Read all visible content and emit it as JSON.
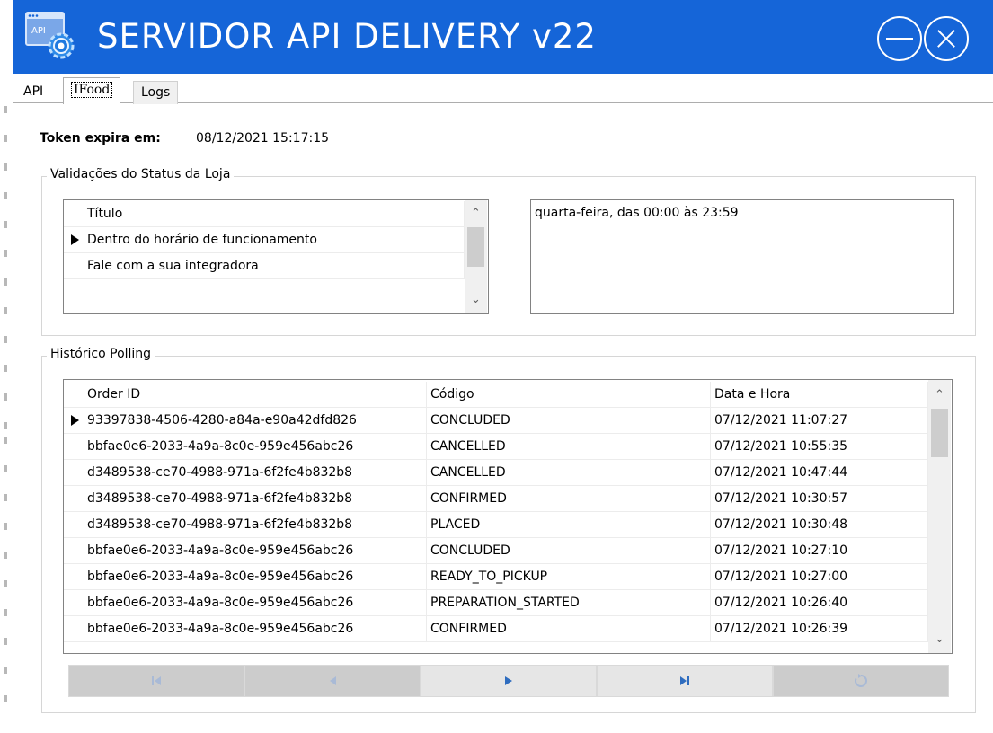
{
  "window": {
    "title": "SERVIDOR API DELIVERY v22",
    "icon_text": "API",
    "icon": "api-gear-icon",
    "accent_color": "#1565d8"
  },
  "tabs": [
    {
      "label": "API"
    },
    {
      "label": "IFood",
      "active": true
    },
    {
      "label": "Logs"
    }
  ],
  "token": {
    "label": "Token expira em:",
    "value": "08/12/2021 15:17:15"
  },
  "status_group": {
    "title": "Validações do Status da Loja",
    "column_header": "Título",
    "rows": [
      {
        "title": "Dentro do horário de funcionamento",
        "selected": true
      },
      {
        "title": "Fale com a sua integradora",
        "selected": false
      }
    ],
    "detail_text": "quarta-feira, das 00:00 às 23:59"
  },
  "polling_group": {
    "title": "Histórico Polling",
    "columns": [
      "Order ID",
      "Código",
      "Data e Hora"
    ],
    "rows": [
      {
        "order_id": "93397838-4506-4280-a84a-e90a42dfd826",
        "code": "CONCLUDED",
        "datetime": "07/12/2021 11:07:27",
        "selected": true
      },
      {
        "order_id": "bbfae0e6-2033-4a9a-8c0e-959e456abc26",
        "code": "CANCELLED",
        "datetime": "07/12/2021 10:55:35"
      },
      {
        "order_id": "d3489538-ce70-4988-971a-6f2fe4b832b8",
        "code": "CANCELLED",
        "datetime": "07/12/2021 10:47:44"
      },
      {
        "order_id": "d3489538-ce70-4988-971a-6f2fe4b832b8",
        "code": "CONFIRMED",
        "datetime": "07/12/2021 10:30:57"
      },
      {
        "order_id": "d3489538-ce70-4988-971a-6f2fe4b832b8",
        "code": "PLACED",
        "datetime": "07/12/2021 10:30:48"
      },
      {
        "order_id": "bbfae0e6-2033-4a9a-8c0e-959e456abc26",
        "code": "CONCLUDED",
        "datetime": "07/12/2021 10:27:10"
      },
      {
        "order_id": "bbfae0e6-2033-4a9a-8c0e-959e456abc26",
        "code": "READY_TO_PICKUP",
        "datetime": "07/12/2021 10:27:00"
      },
      {
        "order_id": "bbfae0e6-2033-4a9a-8c0e-959e456abc26",
        "code": "PREPARATION_STARTED",
        "datetime": "07/12/2021 10:26:40"
      },
      {
        "order_id": "bbfae0e6-2033-4a9a-8c0e-959e456abc26",
        "code": "CONFIRMED",
        "datetime": "07/12/2021 10:26:39"
      }
    ]
  },
  "navigator": {
    "buttons": [
      {
        "icon": "first-record-icon",
        "enabled": false
      },
      {
        "icon": "prior-record-icon",
        "enabled": false
      },
      {
        "icon": "next-record-icon",
        "enabled": true
      },
      {
        "icon": "last-record-icon",
        "enabled": true
      },
      {
        "icon": "refresh-icon",
        "enabled": false
      }
    ]
  }
}
